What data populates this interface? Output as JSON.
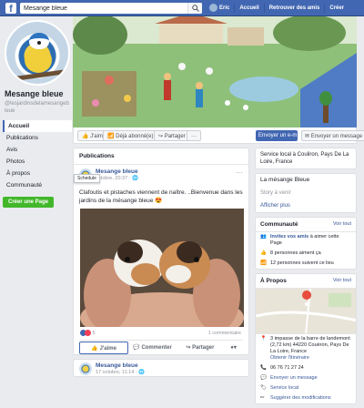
{
  "topbar": {
    "search_value": "Mesange bleue",
    "nav": [
      "Eric",
      "Accueil",
      "Retrouver des amis",
      "Créer"
    ],
    "logo_letter": "f"
  },
  "profile": {
    "name": "Mesange bleue",
    "handle": "@lesjardinsdelamesangebleue",
    "menu": [
      "Accueil",
      "Publications",
      "Avis",
      "Photos",
      "À propos",
      "Communauté"
    ],
    "create_page": "Créer une Page"
  },
  "actions": {
    "like": "J'aime",
    "following": "Déjà abonné(e)",
    "share": "Partager",
    "more": "···",
    "primary": "Envoyer un e-m…",
    "message": "Envoyer un message"
  },
  "feed": {
    "title": "Publications",
    "post": {
      "author": "Mesange bleue",
      "schedule_tip": "Schedule",
      "time": "octobre, 20:37 · ",
      "text": "Clafoutis et pistaches viennent de naître. ..Bienvenue dans les jardins de la mésange bleue 😍",
      "reactions_count": "5",
      "comments": "1 commentaire",
      "actions": [
        "J'aime",
        "Commenter",
        "Partager"
      ]
    },
    "post2": {
      "author": "Mesange bleue",
      "time": "17 octobre, 11:14 · "
    }
  },
  "sidebar": {
    "about_line": "Service local à Couliron, Pays De La Loire, France",
    "story_title": "La mésange Bleue",
    "story_sub": "Story à venir",
    "story_link": "Afficher plus",
    "community": {
      "title": "Communauté",
      "voir": "Voir tout",
      "rows": [
        {
          "pre": "Invitez vos amis",
          "post": " à aimer cette Page"
        },
        {
          "pre": "",
          "post": "8 personnes aiment ça"
        },
        {
          "pre": "",
          "post": "12 personnes suivent ce lieu"
        }
      ]
    },
    "apropos": {
      "title": "À Propos",
      "voir": "Voir tout",
      "address": "3 impasse de la barre de landemont (2,72 km) 44220 Couëron, Pays De La Loire, France",
      "itinerary": "Obtenir l'itinéraire",
      "phone": "06 76 71 27 24",
      "send_msg": "Envoyer un message",
      "service": "Service local",
      "suggest": "Suggérer des modifications"
    }
  },
  "colors": {
    "brand": "#4267b2",
    "link": "#385898",
    "green": "#42b72a"
  }
}
